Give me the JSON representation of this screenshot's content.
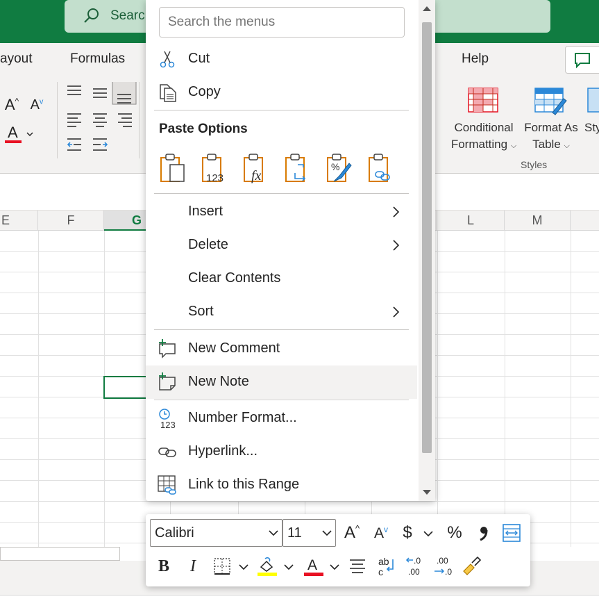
{
  "titlebar": {
    "search_text": "Searc"
  },
  "ribbon_tabs": [
    {
      "label": "ayout"
    },
    {
      "label": "Formulas"
    },
    {
      "label": "Help"
    }
  ],
  "ribbon": {
    "conditional_formatting": "Conditional",
    "conditional_formatting2": "Formatting",
    "format_as_table": "Format As",
    "format_as_table2": "Table",
    "cell_styles": "Sty",
    "styles_group": "Styles"
  },
  "columns": [
    {
      "label": "E"
    },
    {
      "label": "F"
    },
    {
      "label": "G"
    },
    {
      "label": "L"
    },
    {
      "label": "M"
    }
  ],
  "context_menu": {
    "search_placeholder": "Search the menus",
    "cut": "Cut",
    "copy": "Copy",
    "paste_options": "Paste Options",
    "paste_icons": [
      "paste-icon",
      "paste-values-icon",
      "paste-formulas-icon",
      "paste-transpose-icon",
      "paste-formatting-icon",
      "paste-link-icon"
    ],
    "insert": "Insert",
    "delete": "Delete",
    "clear_contents": "Clear Contents",
    "sort": "Sort",
    "new_comment": "New Comment",
    "new_note": "New Note",
    "number_format": "Number Format...",
    "hyperlink": "Hyperlink...",
    "link_to_range": "Link to this Range",
    "hovered_item": "New Note"
  },
  "mini_toolbar": {
    "font": "Calibri",
    "size": "11",
    "colors": {
      "highlight": "#ffff00",
      "font_color": "#e81123"
    }
  },
  "colors": {
    "accent": "#107c41",
    "orange": "#d87b00",
    "blue": "#2b88d8"
  }
}
